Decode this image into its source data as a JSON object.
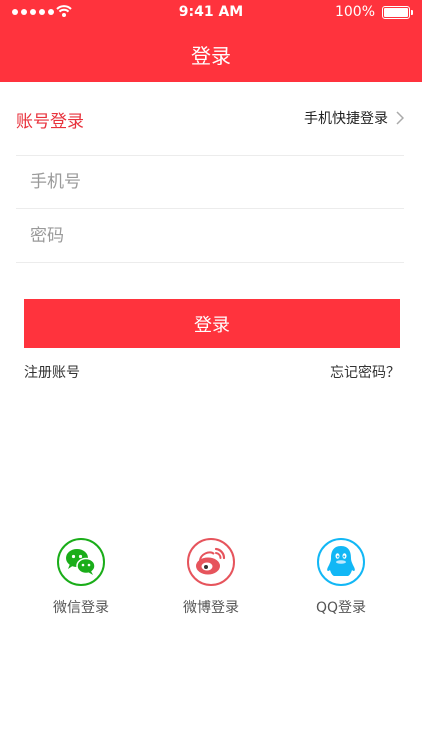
{
  "status_bar": {
    "time": "9:41 AM",
    "battery": "100%"
  },
  "header": {
    "title": "登录"
  },
  "tabs": {
    "account_login": "账号登录",
    "phone_login": "手机快捷登录"
  },
  "form": {
    "phone_placeholder": "手机号",
    "phone_value": "",
    "password_placeholder": "密码",
    "password_value": ""
  },
  "actions": {
    "login_button": "登录",
    "register": "注册账号",
    "forgot_password": "忘记密码？"
  },
  "social": {
    "wechat": "微信登录",
    "weibo": "微博登录",
    "qq": "QQ登录"
  },
  "colors": {
    "brand_red": "#ff333d",
    "wechat_green": "#1aad19",
    "weibo_red": "#e6545c",
    "qq_blue": "#12b7f5"
  },
  "icons": {
    "signal": "signal-dots-icon",
    "wifi": "wifi-icon",
    "battery": "battery-icon",
    "chevron": "chevron-right-icon",
    "wechat": "wechat-icon",
    "weibo": "weibo-icon",
    "qq": "qq-icon"
  }
}
